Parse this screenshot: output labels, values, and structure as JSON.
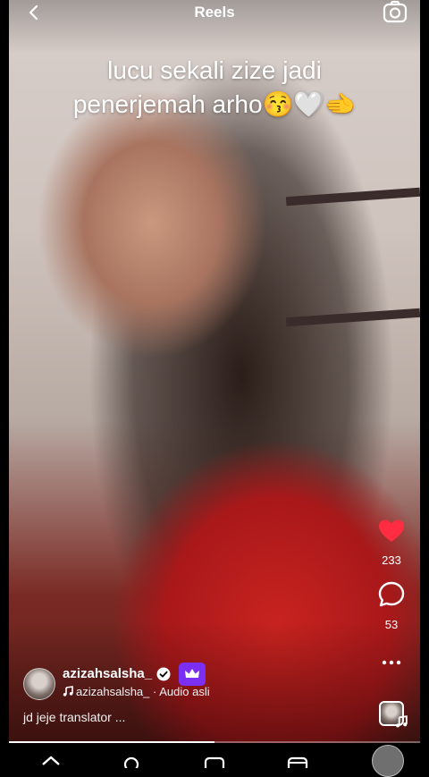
{
  "header": {
    "title": "Reels",
    "back_icon": "chevron-left-icon",
    "camera_icon": "camera-icon"
  },
  "overlay_caption": {
    "line1": "lucu sekali zize jadi",
    "line2": "penerjemah arho😚🤍🫲"
  },
  "actions": {
    "like": {
      "icon": "heart-icon",
      "count": "233",
      "color": "#ff2d3f"
    },
    "comment": {
      "icon": "comment-bubble-icon",
      "count": "53"
    },
    "more": {
      "icon": "more-dots-icon"
    }
  },
  "post": {
    "username": "azizahsalsha_",
    "verified_icon": "verified-badge-icon",
    "subscriber_badge_icon": "crown-icon",
    "badge_color": "#7b2ff2",
    "audio": "azizahsalsha_ · Audio asli",
    "description": "jd jeje translator ..."
  },
  "playback": {
    "progress": 0.5
  },
  "bottom_nav": {
    "items": [
      "home-icon",
      "search-icon",
      "reels-icon",
      "shop-icon",
      "profile-avatar"
    ]
  }
}
